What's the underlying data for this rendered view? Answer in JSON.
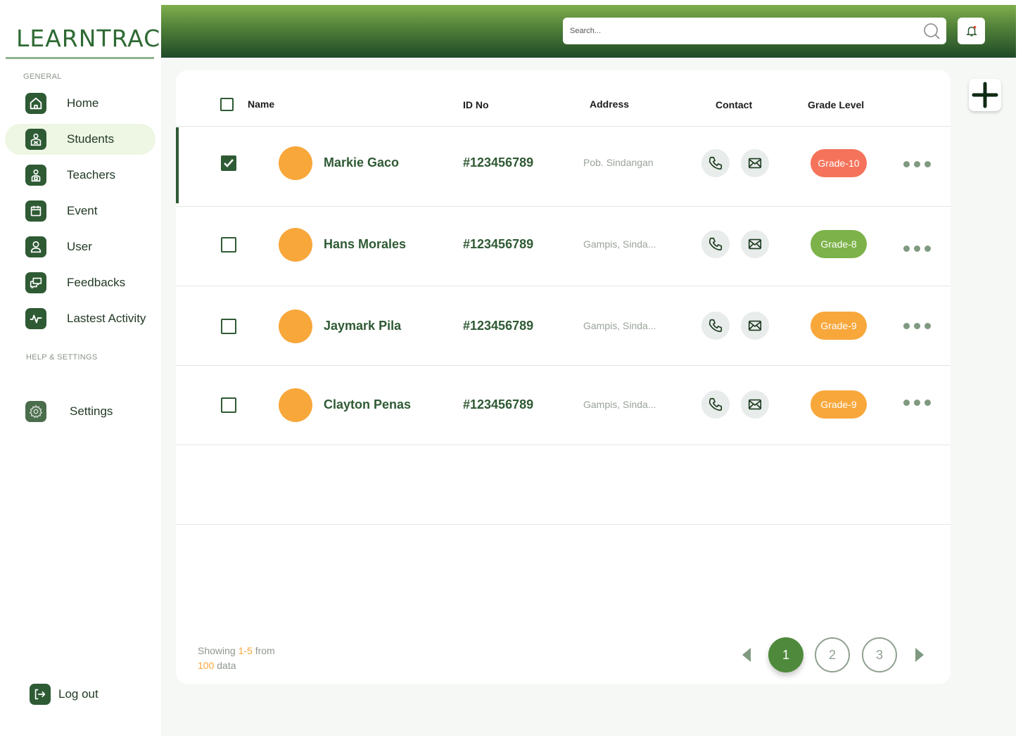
{
  "app": {
    "logo_text": "LEARNTRACK"
  },
  "sidebar": {
    "general_label": "GENERAL",
    "help_label": "HELP & SETTINGS",
    "items": [
      {
        "label": "Home",
        "icon": "home-icon",
        "active": false
      },
      {
        "label": "Students",
        "icon": "student-icon",
        "active": true
      },
      {
        "label": "Teachers",
        "icon": "teacher-icon",
        "active": false
      },
      {
        "label": "Event",
        "icon": "calendar-icon",
        "active": false
      },
      {
        "label": "User",
        "icon": "user-icon",
        "active": false
      },
      {
        "label": "Feedbacks",
        "icon": "chat-icon",
        "active": false
      },
      {
        "label": "Lastest Activity",
        "icon": "activity-icon",
        "active": false
      }
    ],
    "settings_label": "Settings",
    "logout_label": "Log out"
  },
  "header": {
    "search_placeholder": "Search..."
  },
  "table": {
    "columns": [
      "Name",
      "ID No",
      "Address",
      "Contact",
      "Grade Level"
    ],
    "rows": [
      {
        "name": "Markie Gaco",
        "id": "#123456789",
        "address": "Pob. Sindangan",
        "grade": "Grade-10",
        "grade_color": "#f5735a",
        "checked": true
      },
      {
        "name": "Hans Morales",
        "id": "#123456789",
        "address": "Gampis, Sinda...",
        "grade": "Grade-8",
        "grade_color": "#7cb249",
        "checked": false
      },
      {
        "name": "Jaymark Pila",
        "id": "#123456789",
        "address": "Gampis, Sinda...",
        "grade": "Grade-9",
        "grade_color": "#f8a73b",
        "checked": false
      },
      {
        "name": "Clayton Penas",
        "id": "#123456789",
        "address": "Gampis, Sinda...",
        "grade": "Grade-9",
        "grade_color": "#f8a73b",
        "checked": false
      }
    ]
  },
  "footer": {
    "showing_prefix": "Showing ",
    "showing_range": "1-5",
    "showing_from": " from",
    "showing_total": "100",
    "showing_suffix": " data",
    "pages": [
      "1",
      "2",
      "3"
    ],
    "active_page": "1"
  },
  "colors": {
    "primary": "#2f5a34",
    "accent": "#f8a73b",
    "active_page": "#4f8a3c"
  }
}
